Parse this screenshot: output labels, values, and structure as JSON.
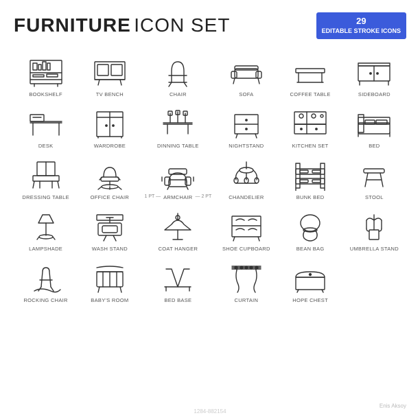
{
  "header": {
    "title": "FURNITURE",
    "subtitle": "ICON SET",
    "badge_count": "29",
    "badge_text": "EDITABLE STROKE ICONS"
  },
  "icons": [
    {
      "id": "bookshelf",
      "label": "BOOKSHELF"
    },
    {
      "id": "tv-bench",
      "label": "TV BENCH"
    },
    {
      "id": "chair",
      "label": "CHAIR"
    },
    {
      "id": "sofa",
      "label": "SOFA"
    },
    {
      "id": "coffee-table",
      "label": "COFFEE TABLE"
    },
    {
      "id": "sideboard",
      "label": "SIDEBOARD"
    },
    {
      "id": "desk",
      "label": "DESK"
    },
    {
      "id": "wardrobe",
      "label": "WARDROBE"
    },
    {
      "id": "dinning-table",
      "label": "DINNING TABLE"
    },
    {
      "id": "nightstand",
      "label": "NIGHTSTAND"
    },
    {
      "id": "kitchen-set",
      "label": "KITCHEN SET"
    },
    {
      "id": "bed",
      "label": "BED"
    },
    {
      "id": "dressing-table",
      "label": "DRESSING TABLE"
    },
    {
      "id": "office-chair",
      "label": "OFFICE CHAIR"
    },
    {
      "id": "armchair",
      "label": "ARMCHAIR"
    },
    {
      "id": "chandelier",
      "label": "CHANDELIER"
    },
    {
      "id": "bunk-bed",
      "label": "BUNK BED"
    },
    {
      "id": "stool",
      "label": "STOOL"
    },
    {
      "id": "lampshade",
      "label": "LAMPSHADE"
    },
    {
      "id": "wash-stand",
      "label": "WASH STAND"
    },
    {
      "id": "coat-hanger",
      "label": "COAT HANGER"
    },
    {
      "id": "shoe-cupboard",
      "label": "SHOE CUPBOARD"
    },
    {
      "id": "bean-bag",
      "label": "BEAN BAG"
    },
    {
      "id": "umbrella-stand",
      "label": "UMBRELLA STAND"
    },
    {
      "id": "rocking-chair",
      "label": "ROCKING CHAIR"
    },
    {
      "id": "babys-room",
      "label": "BABY'S ROOM"
    },
    {
      "id": "bed-base",
      "label": "BED BASE"
    },
    {
      "id": "curtain",
      "label": "CURTAIN"
    },
    {
      "id": "hope-chest",
      "label": "HOPE CHEST"
    }
  ],
  "watermark": "1284-882154",
  "author": "Enis Aksoy"
}
